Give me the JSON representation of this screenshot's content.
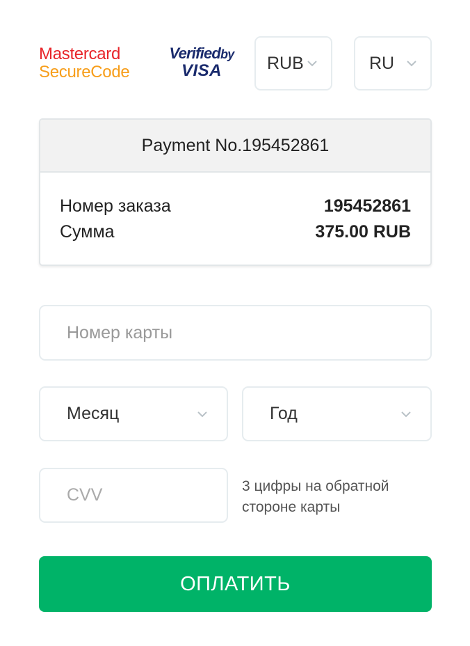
{
  "logos": {
    "mastercard_line1": "Mastercard",
    "mastercard_line2": "SecureCode",
    "visa_verified": "Verified",
    "visa_by": "by",
    "visa_name": "VISA"
  },
  "selectors": {
    "currency": "RUB",
    "language": "RU"
  },
  "payment": {
    "header": "Payment No.195452861",
    "order_label": "Номер заказа",
    "order_value": "195452861",
    "sum_label": "Сумма",
    "sum_value": "375.00 RUB"
  },
  "form": {
    "card_number_placeholder": "Номер карты",
    "month_label": "Месяц",
    "year_label": "Год",
    "cvv_placeholder": "CVV",
    "cvv_hint_line1": "3 цифры на обратной",
    "cvv_hint_line2": "стороне карты"
  },
  "pay_button": "ОПЛАТИТЬ",
  "colors": {
    "accent": "#00b368",
    "mastercard_red": "#e8252a",
    "mastercard_orange": "#f79e1b",
    "visa_blue": "#1a2b6d",
    "border": "#e6ecef"
  },
  "icons": {
    "dropdown": "chevron-down-icon"
  }
}
